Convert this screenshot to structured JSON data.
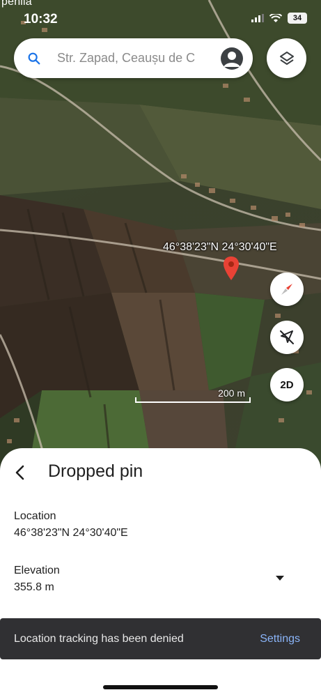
{
  "status_bar": {
    "top_label": "penila",
    "time": "10:32",
    "battery": "34"
  },
  "search": {
    "text": "Str. Zapad, Ceaușu de C"
  },
  "map": {
    "coordinates_label": "46°38'23\"N 24°30'40\"E",
    "scale_label": "200 m",
    "mode_label": "2D"
  },
  "sheet": {
    "title": "Dropped pin",
    "location_label": "Location",
    "location_value": "46°38'23\"N 24°30'40\"E",
    "elevation_label": "Elevation",
    "elevation_value": "355.8 m"
  },
  "snackbar": {
    "message": "Location tracking has been denied",
    "action": "Settings"
  },
  "colors": {
    "pin": "#e94235",
    "accent_link": "#8ab4f8",
    "search_icon": "#1a73e8"
  },
  "icons": [
    "search-icon",
    "account-icon",
    "layers-icon",
    "map-pin-icon",
    "compass-icon",
    "location-off-icon",
    "back-arrow-icon",
    "dropdown-arrow-icon",
    "wifi-icon",
    "signal-icon",
    "battery-icon"
  ]
}
